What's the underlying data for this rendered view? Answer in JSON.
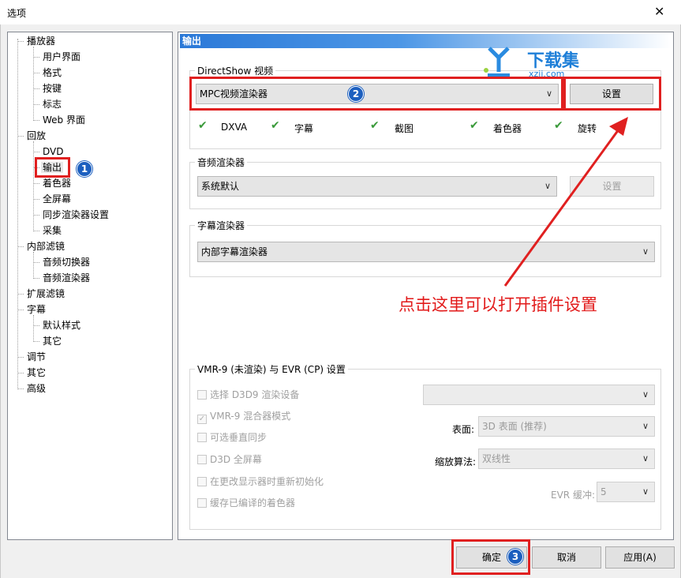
{
  "window": {
    "title": "选项"
  },
  "tree": {
    "items": [
      {
        "label": "播放器",
        "level": 0
      },
      {
        "label": "用户界面",
        "level": 1
      },
      {
        "label": "格式",
        "level": 1
      },
      {
        "label": "按键",
        "level": 1
      },
      {
        "label": "标志",
        "level": 1
      },
      {
        "label": "Web 界面",
        "level": 1
      },
      {
        "label": "回放",
        "level": 0
      },
      {
        "label": "DVD",
        "level": 1
      },
      {
        "label": "输出",
        "level": 1,
        "selected": true
      },
      {
        "label": "着色器",
        "level": 1
      },
      {
        "label": "全屏幕",
        "level": 1
      },
      {
        "label": "同步渲染器设置",
        "level": 1
      },
      {
        "label": "采集",
        "level": 1
      },
      {
        "label": "内部滤镜",
        "level": 0
      },
      {
        "label": "音频切换器",
        "level": 1
      },
      {
        "label": "音频渲染器",
        "level": 1
      },
      {
        "label": "扩展滤镜",
        "level": 0
      },
      {
        "label": "字幕",
        "level": 0
      },
      {
        "label": "默认样式",
        "level": 1
      },
      {
        "label": "其它",
        "level": 1
      },
      {
        "label": "调节",
        "level": 0
      },
      {
        "label": "其它",
        "level": 0
      },
      {
        "label": "高级",
        "level": 0
      }
    ]
  },
  "panel": {
    "header": "输出",
    "directshow": {
      "legend": "DirectShow 视频",
      "renderer_value": "MPC视频渲染器",
      "settings_label": "设置",
      "features": [
        "DXVA",
        "字幕",
        "截图",
        "着色器",
        "旋转"
      ]
    },
    "audio": {
      "legend": "音频渲染器",
      "value": "系统默认",
      "settings_label": "设置"
    },
    "subtitle": {
      "legend": "字幕渲染器",
      "value": "内部字幕渲染器"
    },
    "vmr": {
      "legend": "VMR-9 (未渲染) 与 EVR (CP) 设置",
      "checkboxes": [
        {
          "label": "选择 D3D9 渲染设备",
          "checked": false
        },
        {
          "label": "VMR-9 混合器模式",
          "checked": true
        },
        {
          "label": "可选垂直同步",
          "checked": false
        },
        {
          "label": "D3D 全屏幕",
          "checked": false
        },
        {
          "label": "在更改显示器时重新初始化",
          "checked": false
        },
        {
          "label": "缓存已编译的着色器",
          "checked": false
        }
      ],
      "surface_label": "表面:",
      "surface_value": "3D 表面 (推荐)",
      "resize_label": "缩放算法:",
      "resize_value": "双线性",
      "evr_label": "EVR 缓冲:",
      "evr_value": "5"
    }
  },
  "buttons": {
    "ok": "确定",
    "cancel": "取消",
    "apply": "应用(A)"
  },
  "annotations": {
    "text": "点击这里可以打开插件设置",
    "badges": [
      "1",
      "2",
      "3"
    ],
    "color": "#e21a1a"
  },
  "watermark": {
    "main": "下载集",
    "sub": "xzji.com"
  }
}
